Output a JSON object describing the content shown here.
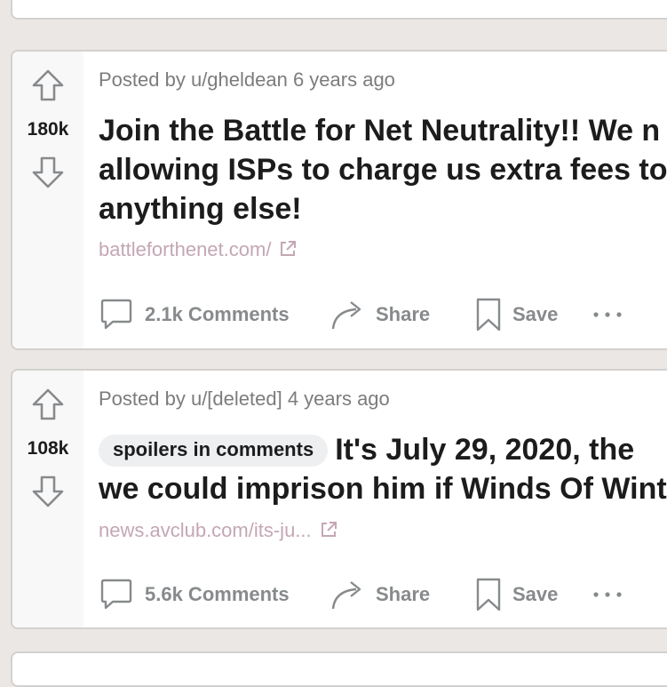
{
  "posts": [
    {
      "score": "180k",
      "meta": "Posted by u/gheldean 6 years ago",
      "title_lines": [
        "Join the Battle for Net Neutrality!! We n",
        "allowing ISPs to charge us extra fees to",
        "anything else!"
      ],
      "link": "battleforthenet.com/",
      "comments_label": "2.1k Comments",
      "share_label": "Share",
      "save_label": "Save"
    },
    {
      "score": "108k",
      "meta": "Posted by u/[deleted] 4 years ago",
      "flair": "spoilers in comments",
      "title_lines": [
        "It's July 29, 2020, the",
        "we could imprison him if Winds Of Wint"
      ],
      "link": "news.avclub.com/its-ju...",
      "comments_label": "5.6k Comments",
      "share_label": "Share",
      "save_label": "Save"
    }
  ],
  "colors": {
    "background": "#ebe7e4",
    "text": "#1c1c1c",
    "meta": "#7c7c7c",
    "link": "#c4a7b4",
    "action": "#878a8c",
    "flair_bg": "#edeff1"
  },
  "icons": {
    "upvote": "upvote-arrow-icon",
    "downvote": "downvote-arrow-icon",
    "comment": "comment-bubble-icon",
    "share": "share-arrow-icon",
    "save": "bookmark-icon",
    "more": "more-dots-icon",
    "external": "external-link-icon"
  }
}
